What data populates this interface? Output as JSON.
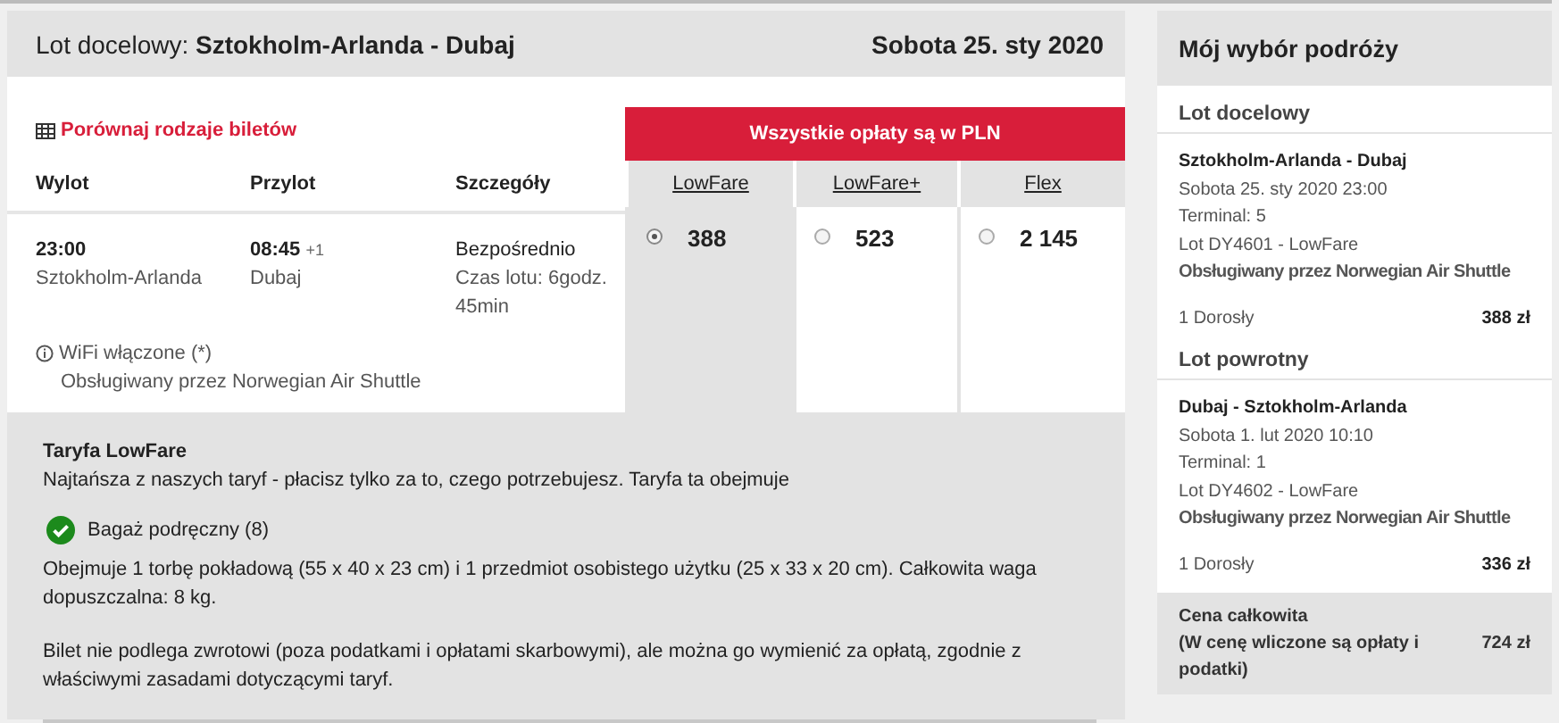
{
  "header": {
    "label": "Lot docelowy:",
    "route": "Sztokholm-Arlanda - Dubaj",
    "date": "Sobota 25. sty 2020"
  },
  "compare_link": "Porównaj rodzaje biletów",
  "currency_banner": "Wszystkie opłaty są w PLN",
  "columns": [
    "Wylot",
    "Przylot",
    "Szczegóły"
  ],
  "flight": {
    "departure_time": "23:00",
    "departure_airport": "Sztokholm-Arlanda",
    "arrival_time": "08:45",
    "day_offset": "+1",
    "arrival_airport": "Dubaj",
    "type": "Bezpośrednio",
    "duration": "Czas lotu: 6godz. 45min",
    "wifi": "WiFi włączone (*)",
    "operator": "Obsługiwany przez Norwegian Air Shuttle"
  },
  "fares": [
    {
      "name": "LowFare",
      "price": "388",
      "selected": true
    },
    {
      "name": "LowFare+",
      "price": "523",
      "selected": false
    },
    {
      "name": "Flex",
      "price": "2 145",
      "selected": false
    }
  ],
  "fare_details": {
    "title": "Taryfa LowFare",
    "intro": "Najtańsza z naszych taryf - płacisz tylko za to, czego potrzebujesz. Taryfa ta obejmuje",
    "items": [
      {
        "label": "Bagaż podręczny (8)",
        "included": true
      }
    ],
    "baggage_note": "Obejmuje 1 torbę pokładową (55 x 40 x 23 cm) i 1 przedmiot osobistego użytku (25 x 33 x 20 cm). Całkowita waga dopuszczalna: 8 kg.",
    "refund_note": "Bilet nie podlega zwrotowi (poza podatkami i opłatami skarbowymi), ale można go wymienić za opłatą, zgodnie z właściwymi zasadami dotyczącymi taryf."
  },
  "summary": {
    "title": "Mój wybór podróży",
    "legs": [
      {
        "heading": "Lot docelowy",
        "route": "Sztokholm-Arlanda - Dubaj",
        "datetime": "Sobota 25. sty 2020 23:00",
        "terminal": "Terminal: 5",
        "flight": "Lot DY4601 - LowFare",
        "operator": "Obsługiwany przez Norwegian Air Shuttle",
        "passengers": "1 Dorosły",
        "price": "388 zł"
      },
      {
        "heading": "Lot powrotny",
        "route": "Dubaj - Sztokholm-Arlanda",
        "datetime": "Sobota 1. lut 2020 10:10",
        "terminal": "Terminal: 1",
        "flight": "Lot DY4602 - LowFare",
        "operator": "Obsługiwany przez Norwegian Air Shuttle",
        "passengers": "1 Dorosły",
        "price": "336 zł"
      }
    ],
    "total": {
      "label": "Cena całkowita",
      "note": "(W cenę wliczone są opłaty i podatki)",
      "price": "724 zł"
    }
  }
}
